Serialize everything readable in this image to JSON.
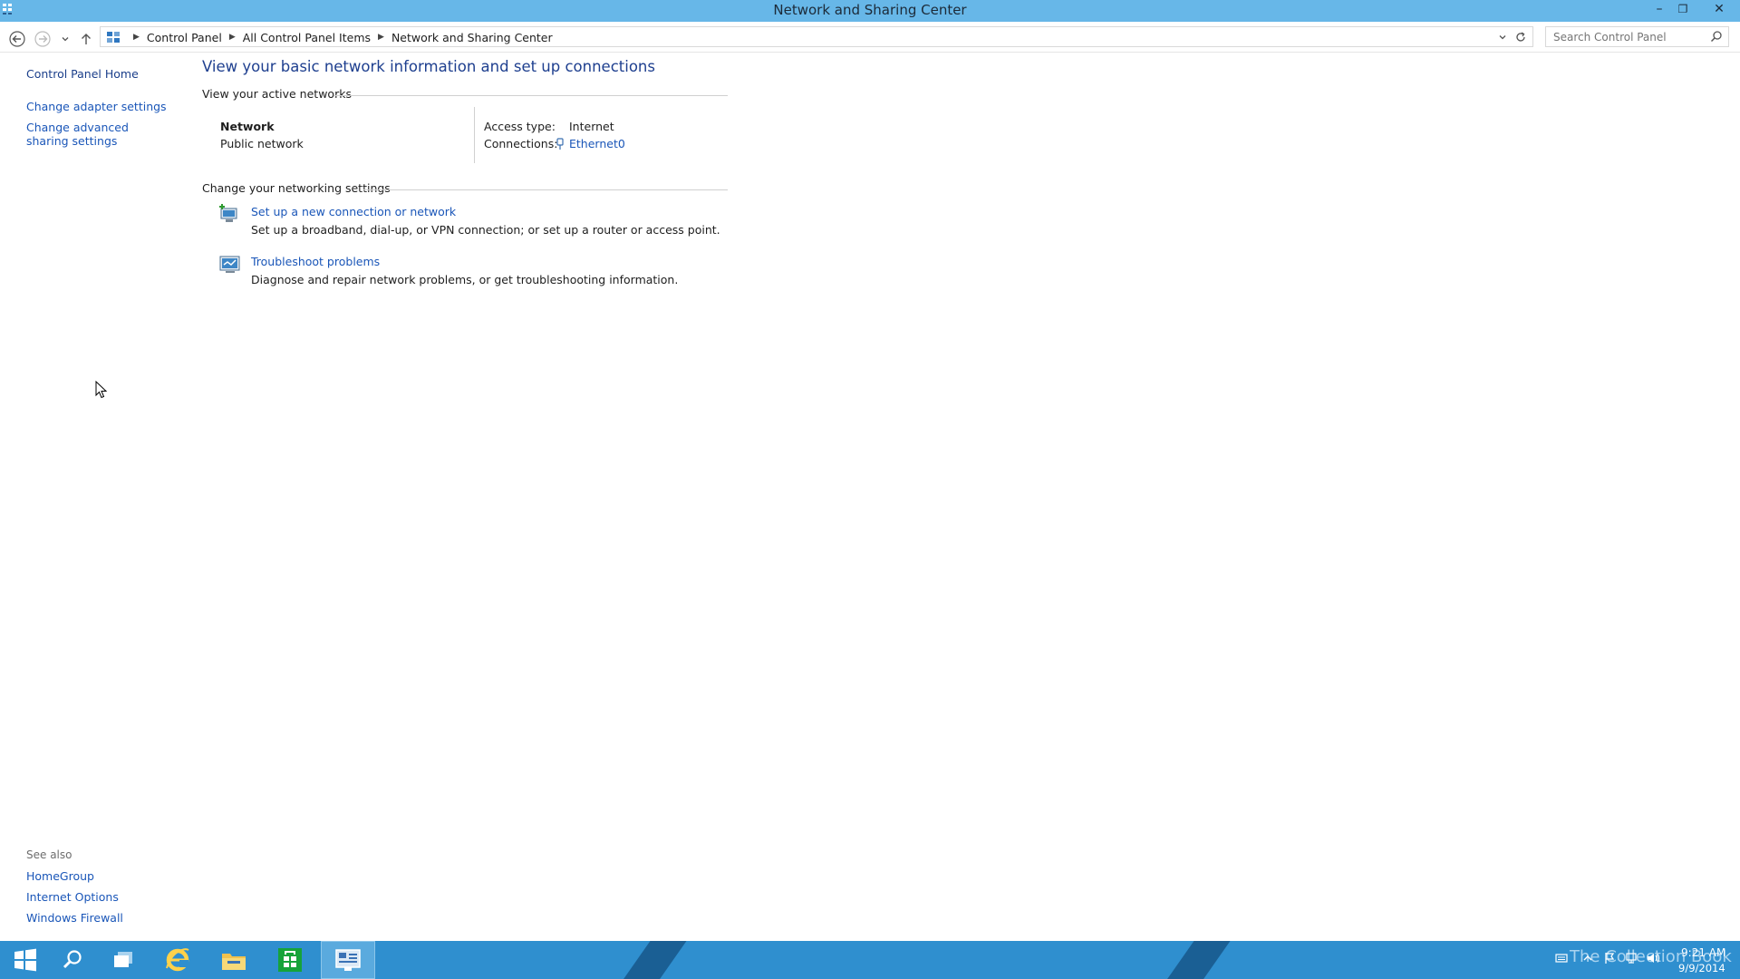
{
  "window": {
    "title": "Network and Sharing Center",
    "minimize_glyph": "–",
    "restore_glyph": "❐",
    "close_glyph": "✕"
  },
  "address_bar": {
    "breadcrumbs": [
      "Control Panel",
      "All Control Panel Items",
      "Network and Sharing Center"
    ],
    "search_placeholder": "Search Control Panel"
  },
  "left_pane": {
    "links": [
      "Control Panel Home",
      "Change adapter settings",
      "Change advanced sharing settings"
    ],
    "see_also_label": "See also",
    "see_also": [
      "HomeGroup",
      "Internet Options",
      "Windows Firewall"
    ]
  },
  "main": {
    "title": "View your basic network information and set up connections",
    "active_networks_heading": "View your active networks",
    "network": {
      "name": "Network",
      "type": "Public network",
      "access_type_label": "Access type:",
      "access_type_value": "Internet",
      "connections_label": "Connections:",
      "connection_name": "Ethernet0"
    },
    "change_settings_heading": "Change your networking settings",
    "tasks": [
      {
        "label": "Set up a new connection or network",
        "description": "Set up a broadband, dial-up, or VPN connection; or set up a router or access point."
      },
      {
        "label": "Troubleshoot problems",
        "description": "Diagnose and repair network problems, or get troubleshooting information."
      }
    ]
  },
  "taskbar": {
    "watermark": "The Collection Book",
    "time": "9:21 AM",
    "date": "9/9/2014",
    "accent_color": "#2f8fcf"
  }
}
